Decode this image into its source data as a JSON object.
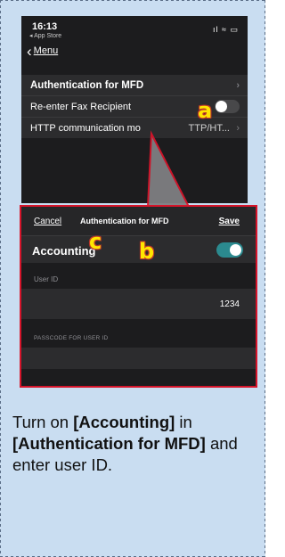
{
  "phone": {
    "time": "16:13",
    "back_app": "◂ App Store",
    "status_icons": "ıl ≈ ▭",
    "nav_back_label": "Menu",
    "rows": [
      {
        "label": "Authentication for MFD"
      },
      {
        "label": "Re-enter Fax Recipient"
      },
      {
        "label": "HTTP communication mo",
        "value": "TTP/HT..."
      }
    ]
  },
  "sheet": {
    "cancel_label": "Cancel",
    "title": "Authentication for MFD",
    "save_label": "Save",
    "accounting_label": "Accounting",
    "accounting_on": true,
    "user_id_label": "User ID",
    "user_id_value": "1234",
    "passcode_label": "PASSCODE FOR USER ID"
  },
  "badges": {
    "a": "a",
    "b": "b",
    "c": "c"
  },
  "instruction": {
    "t1": "Turn on ",
    "b1": "[Accounting]",
    "t2": " in ",
    "b2": "[Authentication for MFD]",
    "t3": " and enter user ID."
  },
  "colors": {
    "highlight_frame": "#d6142a",
    "badge": "#ffe600",
    "toggle_on": "#2b8a8f",
    "panel": "#c9ddf1"
  }
}
